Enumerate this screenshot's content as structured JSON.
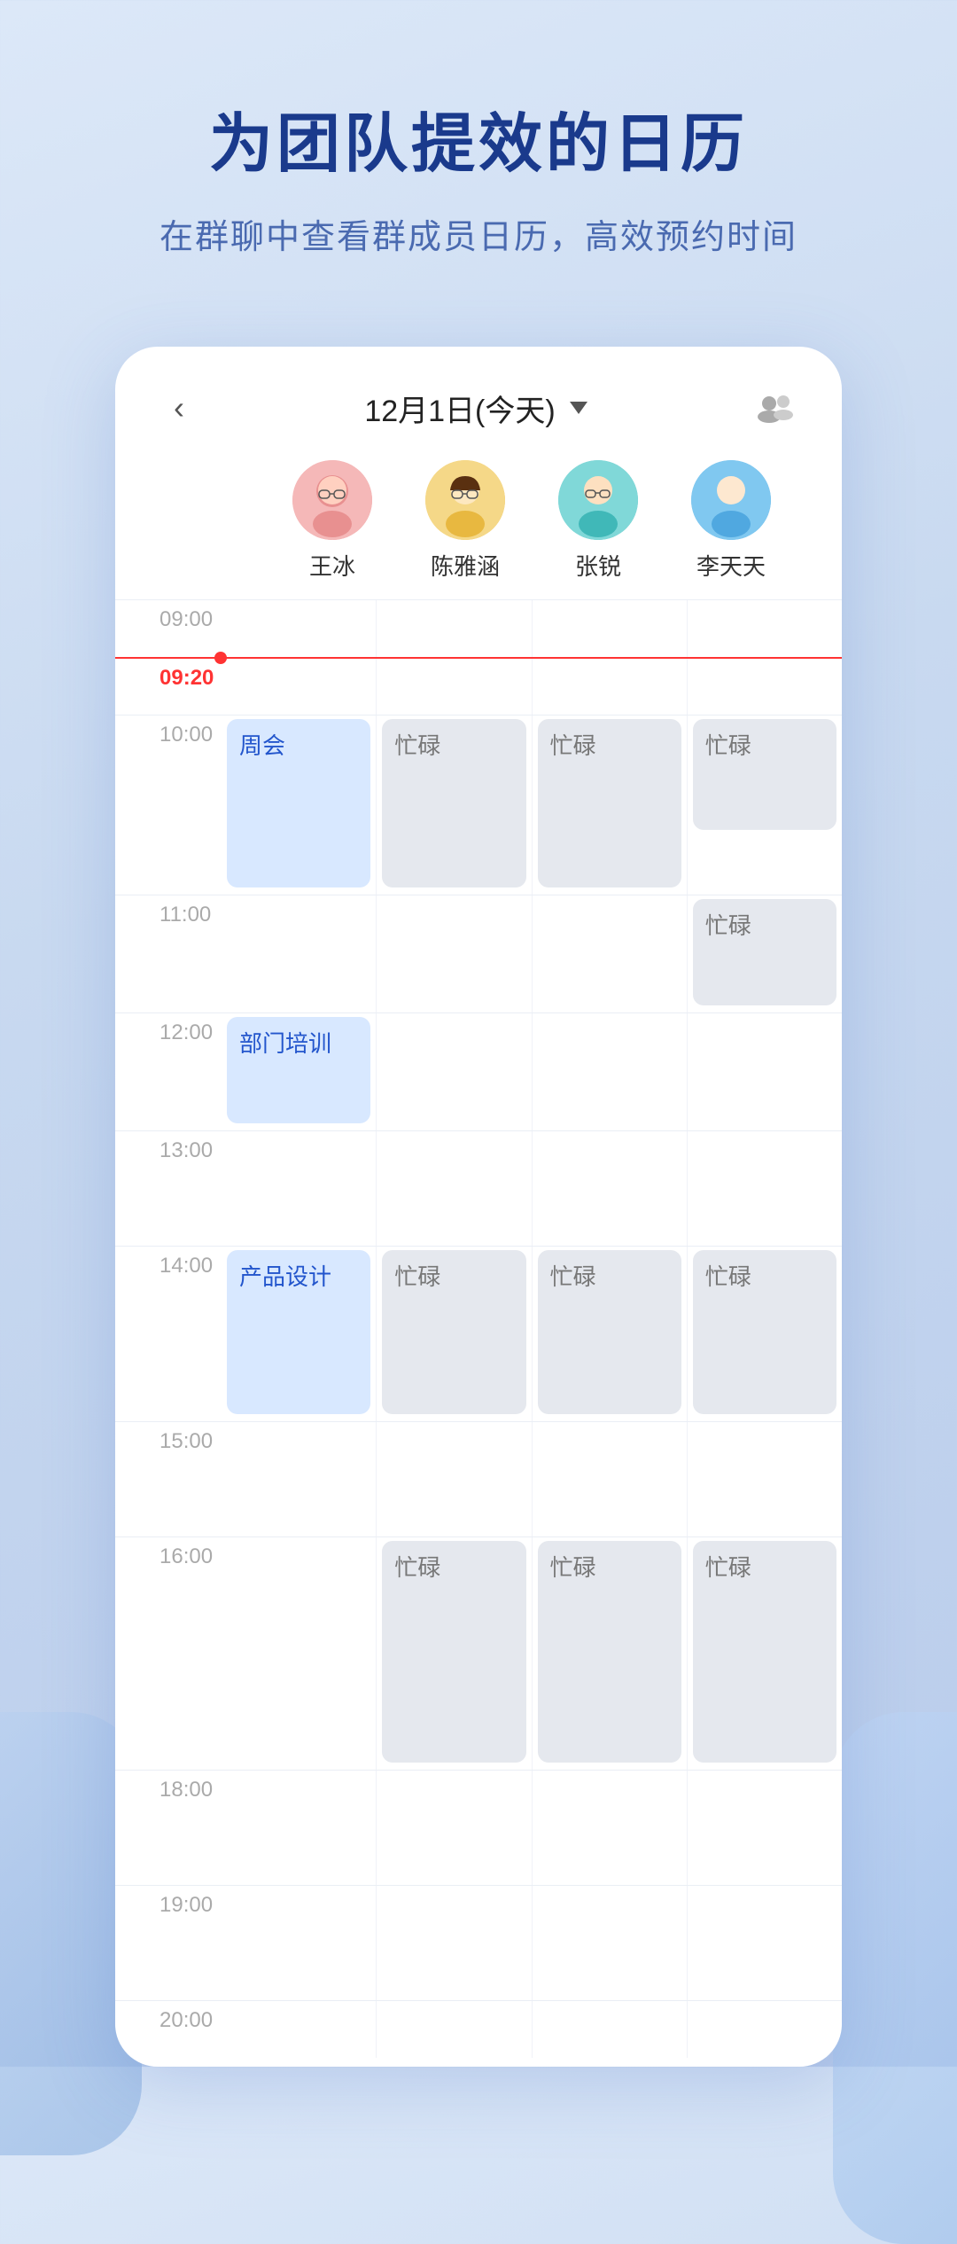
{
  "hero": {
    "title": "为团队提效的日历",
    "subtitle": "在群聊中查看群成员日历，高效预约时间"
  },
  "calendar": {
    "header": {
      "back_label": "‹",
      "date_label": "12月1日(今天)",
      "date_arrow": "▼",
      "group_icon_label": "group-members-icon"
    },
    "members": [
      {
        "name": "王冰",
        "color": "pink",
        "emoji": "👩"
      },
      {
        "name": "陈雅涵",
        "color": "yellow",
        "emoji": "👩‍🦱"
      },
      {
        "name": "张锐",
        "color": "teal",
        "emoji": "👨"
      },
      {
        "name": "李天天",
        "color": "blue",
        "emoji": "👩"
      }
    ],
    "times": [
      "09:00",
      "09:20",
      "10:00",
      "11:00",
      "12:00",
      "13:00",
      "14:00",
      "15:00",
      "16:00",
      "18:00",
      "19:00",
      "20:00"
    ],
    "events": {
      "zhouhui": {
        "label": "周会",
        "type": "blue"
      },
      "bumen": {
        "label": "部门培训",
        "type": "blue"
      },
      "chanpin": {
        "label": "产品设计",
        "type": "blue"
      },
      "mang": {
        "label": "忙碌",
        "type": "gray"
      }
    }
  }
}
